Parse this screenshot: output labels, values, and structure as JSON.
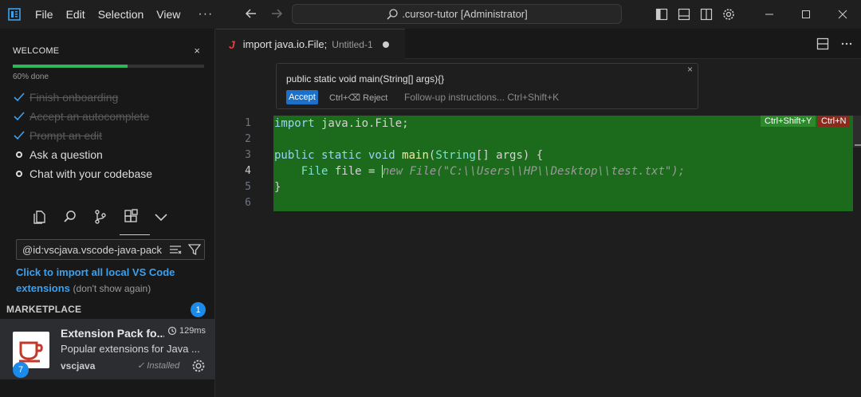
{
  "titlebar": {
    "menu": [
      "File",
      "Edit",
      "Selection",
      "View"
    ],
    "more": "···",
    "command_center": ".cursor-tutor [Administrator]"
  },
  "welcome": {
    "title": "WELCOME",
    "close": "×",
    "progress_percent": 60,
    "progress_label": "60% done",
    "steps": [
      {
        "label": "Finish onboarding",
        "done": true
      },
      {
        "label": "Accept an autocomplete",
        "done": true
      },
      {
        "label": "Prompt an edit",
        "done": true
      },
      {
        "label": "Ask a question",
        "done": false
      },
      {
        "label": "Chat with your codebase",
        "done": false
      }
    ]
  },
  "extensions": {
    "search_value": "@id:vscjava.vscode-java-pack",
    "import_link": "Click to import all local VS Code extensions",
    "dont_show": "(don't show again)",
    "marketplace_header": "MARKETPLACE",
    "marketplace_count": "1",
    "item": {
      "name": "Extension Pack fo...",
      "time": "129ms",
      "description": "Popular extensions for Java ...",
      "publisher": "vscjava",
      "installed": "Installed",
      "badge": "7"
    }
  },
  "editor": {
    "tab": {
      "name": "import java.io.File;",
      "hint": "Untitled-1"
    },
    "prompt": {
      "text": "public static void main(String[] args){}",
      "close": "×",
      "accept": "Accept",
      "reject": "Ctrl+⌫ Reject",
      "followup": "Follow-up instructions... Ctrl+Shift+K"
    },
    "line_numbers": [
      "1",
      "2",
      "3",
      "4",
      "5",
      "6"
    ],
    "code": {
      "l1_kw": "import",
      "l1_rest": " java.io.File;",
      "l3_kw": "public static void",
      "l3_fn": "main",
      "l3_p1": "(",
      "l3_ty": "String",
      "l3_p2": "[] args) {",
      "l4_indent": "    ",
      "l4_ty": "File",
      "l4_rest": " file = ",
      "l4_ghost": "new File(\"C:\\\\Users\\\\HP\\\\Desktop\\\\test.txt\");",
      "l5": "}"
    },
    "accept_key": "Ctrl+Shift+Y",
    "reject_key": "Ctrl+N"
  },
  "colors": {
    "diff_highlight": "#1c6b1c",
    "accent": "#1c8ae8",
    "progress": "#2fb55c"
  }
}
